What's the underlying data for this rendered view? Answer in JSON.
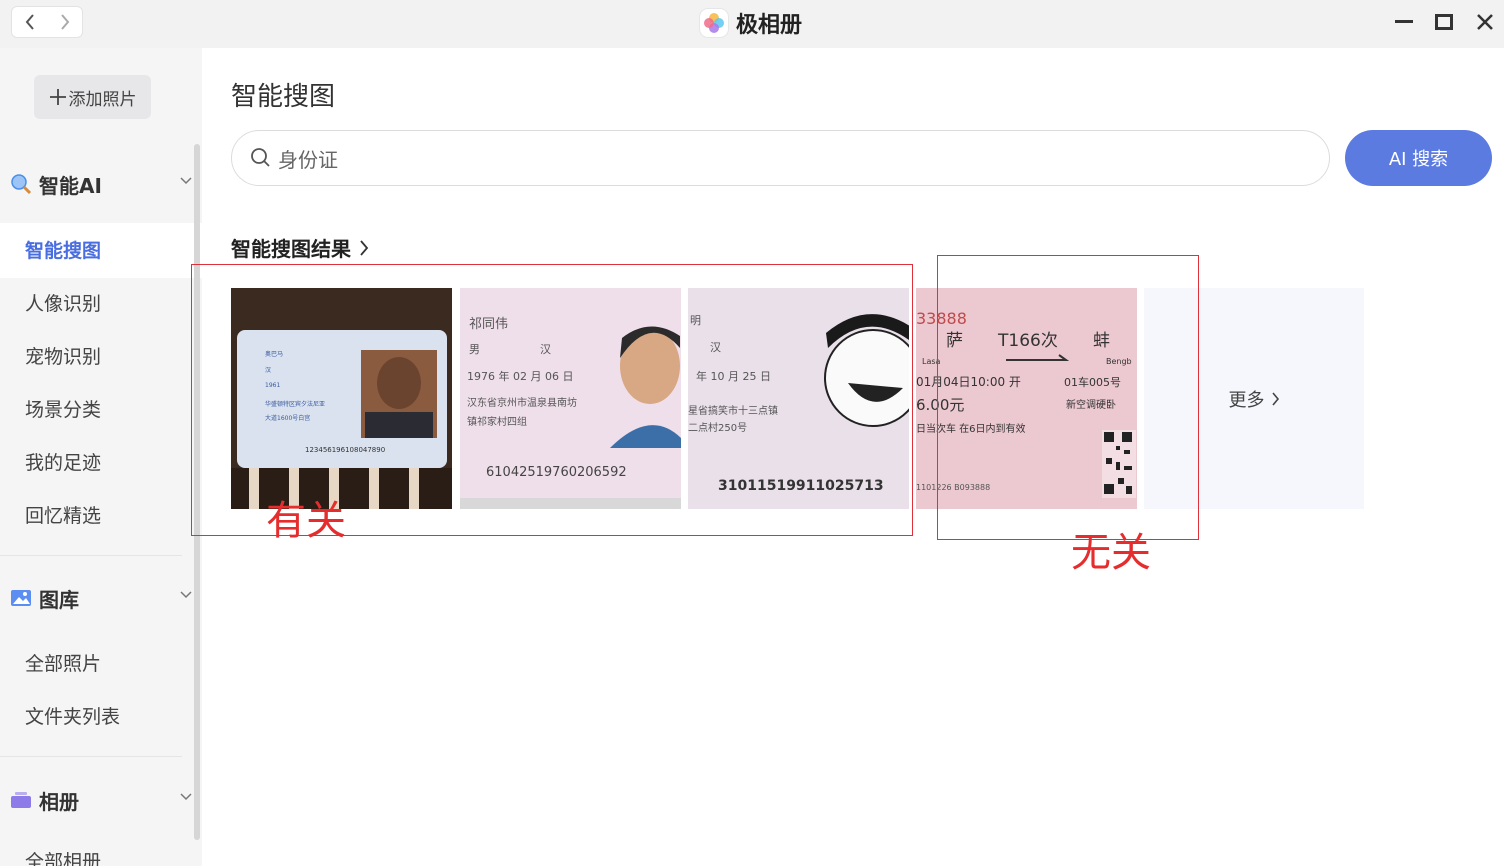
{
  "window": {
    "title": "极相册"
  },
  "sidebar": {
    "add_button": "添加照片",
    "groups": [
      {
        "label": "智能AI",
        "items": [
          "智能搜图",
          "人像识别",
          "宠物识别",
          "场景分类",
          "我的足迹",
          "回忆精选"
        ]
      },
      {
        "label": "图库",
        "items": [
          "全部照片",
          "文件夹列表"
        ]
      },
      {
        "label": "相册",
        "items": [
          "全部相册"
        ]
      }
    ],
    "active_item": "智能搜图"
  },
  "main": {
    "title": "智能搜图",
    "search": {
      "value": "身份证",
      "button": "AI 搜索"
    },
    "results_title": "智能搜图结果",
    "more_label": "更多",
    "thumbnails": [
      {
        "name": "奥巴马",
        "ethnic": "汉",
        "year": "1961",
        "address1": "华盛顿特区宾夕法尼亚",
        "address2": "大道1600号白宫",
        "id_number": "123456196108047890"
      },
      {
        "name": "祁同伟",
        "gender": "男",
        "ethnic": "汉",
        "birth": "1976 年 02 月 06 日",
        "address1": "汉东省京州市温泉县南坊",
        "address2": "镇祁家村四组",
        "id_number": "61042519760206592"
      },
      {
        "name": "明",
        "ethnic": "汉",
        "birth": "年 10 月 25 日",
        "address1": "星省搞笑市十三点镇",
        "address2": "二点村250号",
        "id_number": "31011519911025713"
      },
      {
        "serial": "33888",
        "from": "萨",
        "from_pinyin": "Lasa",
        "train": "T166次",
        "to": "蚌",
        "to_pinyin": "Bengb",
        "datetime": "01月04日10:00 开",
        "seat": "01车005号",
        "price": "6.00元",
        "seat_class": "新空调硬卧",
        "note": "日当次车 在6日内到有效",
        "footer": "1101226 B093888"
      }
    ],
    "annotations": {
      "related": "有关",
      "unrelated": "无关"
    }
  },
  "colors": {
    "accent": "#5b7be1",
    "annotation": "#e52d2d"
  }
}
